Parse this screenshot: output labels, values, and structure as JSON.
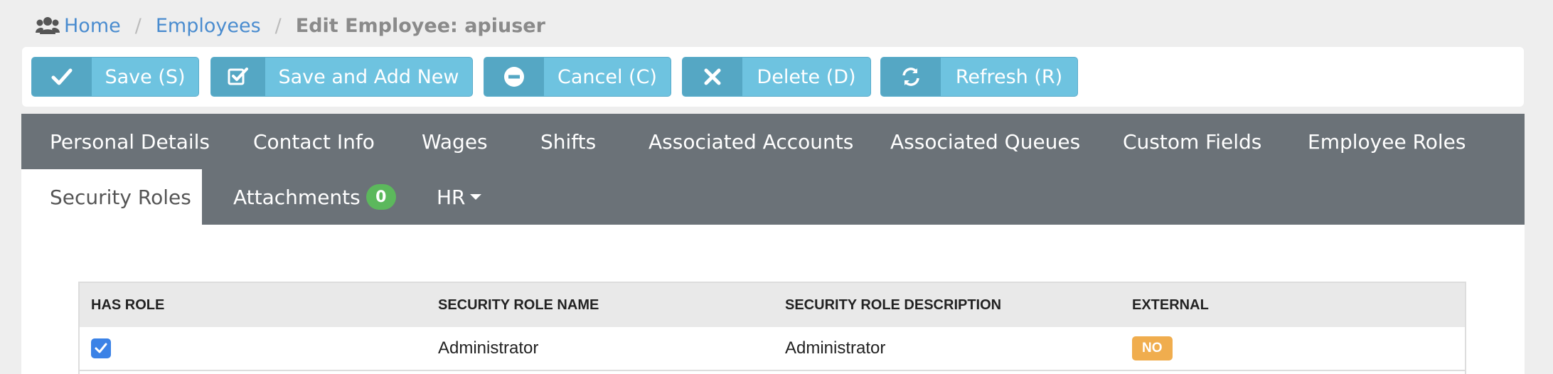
{
  "breadcrumb": {
    "icon": "users-icon",
    "home": "Home",
    "separator": "/",
    "employees": "Employees",
    "current": "Edit Employee: apiuser"
  },
  "toolbar": {
    "buttons": [
      {
        "icon": "check-icon",
        "label": "Save (S)"
      },
      {
        "icon": "check-square-icon",
        "label": "Save and Add New"
      },
      {
        "icon": "minus-circle-icon",
        "label": "Cancel (C)"
      },
      {
        "icon": "close-icon",
        "label": "Delete (D)"
      },
      {
        "icon": "refresh-icon",
        "label": "Refresh (R)"
      }
    ]
  },
  "tabs": {
    "items": [
      {
        "label": "Personal Details"
      },
      {
        "label": "Contact Info"
      },
      {
        "label": "Wages"
      },
      {
        "label": "Shifts"
      },
      {
        "label": "Associated Accounts"
      },
      {
        "label": "Associated Queues"
      },
      {
        "label": "Custom Fields"
      },
      {
        "label": "Employee Roles"
      },
      {
        "label": "Security Roles",
        "active": true
      },
      {
        "label": "Attachments",
        "badge": "0"
      },
      {
        "label": "HR"
      }
    ]
  },
  "table": {
    "headers": [
      "HAS ROLE",
      "SECURITY ROLE NAME",
      "SECURITY ROLE DESCRIPTION",
      "EXTERNAL"
    ],
    "rows": [
      {
        "has_role": true,
        "name": "Administrator",
        "description": "Administrator",
        "external": "NO"
      }
    ]
  },
  "colors": {
    "button": "#6ec3e0",
    "button_icon": "#55a7c4",
    "tab_bar": "#6b7278",
    "badge": "#5cb85c",
    "label_no": "#f0ad4e",
    "checkbox": "#3b82e6",
    "link": "#4a8ccf"
  }
}
